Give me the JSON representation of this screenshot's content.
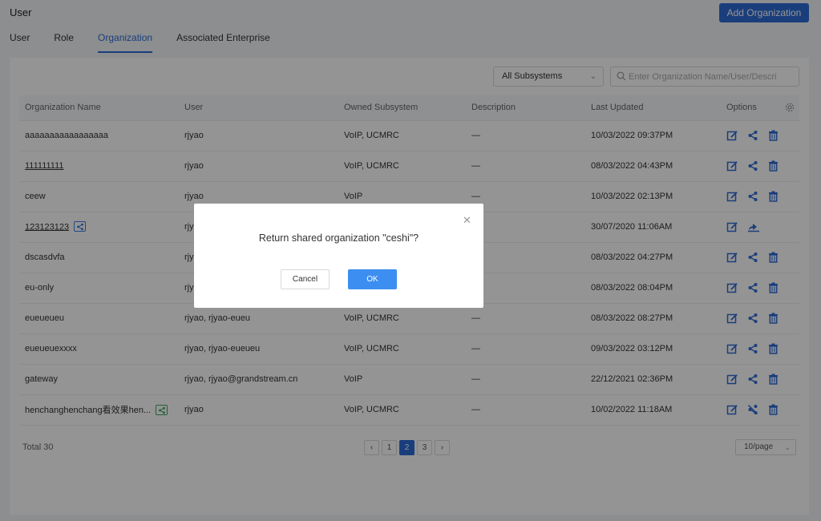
{
  "page": {
    "title": "User",
    "add_button": "Add Organization"
  },
  "tabs": [
    {
      "label": "User",
      "active": false
    },
    {
      "label": "Role",
      "active": false
    },
    {
      "label": "Organization",
      "active": true
    },
    {
      "label": "Associated Enterprise",
      "active": false
    }
  ],
  "filters": {
    "subsystem_selected": "All Subsystems",
    "search_placeholder": "Enter Organization Name/User/Descri"
  },
  "table": {
    "columns": [
      "Organization Name",
      "User",
      "Owned Subsystem",
      "Description",
      "Last Updated",
      "Options"
    ],
    "rows": [
      {
        "name": "aaaaaaaaaaaaaaaaa",
        "user": "rjyao",
        "subsystem": "VoIP, UCMRC",
        "description": "—",
        "updated": "10/03/2022 09:37PM",
        "badge": "",
        "underline": false,
        "share_icon": "share-icon",
        "deletable": true
      },
      {
        "name": "111111111",
        "user": "rjyao",
        "subsystem": "VoIP, UCMRC",
        "description": "—",
        "updated": "08/03/2022 04:43PM",
        "badge": "",
        "underline": true,
        "share_icon": "share-icon",
        "deletable": true
      },
      {
        "name": "ceew",
        "user": "rjyao",
        "subsystem": "VoIP",
        "description": "—",
        "updated": "10/03/2022 02:13PM",
        "badge": "",
        "underline": false,
        "share_icon": "share-icon",
        "deletable": true
      },
      {
        "name": "123123123",
        "user": "rjy",
        "subsystem": "",
        "description": "",
        "updated": "30/07/2020 11:06AM",
        "badge": "blue",
        "underline": true,
        "share_icon": "return-share-icon",
        "deletable": false
      },
      {
        "name": "dscasdvfa",
        "user": "rjy",
        "subsystem": "",
        "description": "",
        "updated": "08/03/2022 04:27PM",
        "badge": "",
        "underline": false,
        "share_icon": "share-icon",
        "deletable": true
      },
      {
        "name": "eu-only",
        "user": "rjy",
        "subsystem": "",
        "description": "",
        "updated": "08/03/2022 08:04PM",
        "badge": "",
        "underline": false,
        "share_icon": "share-icon",
        "deletable": true
      },
      {
        "name": "eueueueu",
        "user": "rjyao, rjyao-eueu",
        "subsystem": "VoIP, UCMRC",
        "description": "—",
        "updated": "08/03/2022 08:27PM",
        "badge": "",
        "underline": false,
        "share_icon": "share-icon",
        "deletable": true
      },
      {
        "name": "eueueuexxxx",
        "user": "rjyao, rjyao-eueueu",
        "subsystem": "VoIP, UCMRC",
        "description": "—",
        "updated": "09/03/2022 03:12PM",
        "badge": "",
        "underline": false,
        "share_icon": "share-icon",
        "deletable": true
      },
      {
        "name": "gateway",
        "user": "rjyao, rjyao@grandstream.cn",
        "subsystem": "VoIP",
        "description": "—",
        "updated": "22/12/2021 02:36PM",
        "badge": "",
        "underline": false,
        "share_icon": "share-icon",
        "deletable": true
      },
      {
        "name": "henchanghenchang看效果hen...",
        "user": "rjyao",
        "subsystem": "VoIP, UCMRC",
        "description": "—",
        "updated": "10/02/2022 11:18AM",
        "badge": "green",
        "underline": false,
        "share_icon": "unshare-icon",
        "deletable": true
      }
    ]
  },
  "footer": {
    "total": "Total 30",
    "pages": [
      "1",
      "2",
      "3"
    ],
    "current_page": "2",
    "per_page": "10/page"
  },
  "dialog": {
    "message": "Return shared organization \"ceshi\"?",
    "cancel": "Cancel",
    "ok": "OK"
  },
  "colors": {
    "accent": "#2e6bd6",
    "ok_button": "#3c8ef0",
    "icon_blue": "#2e6bd6"
  }
}
